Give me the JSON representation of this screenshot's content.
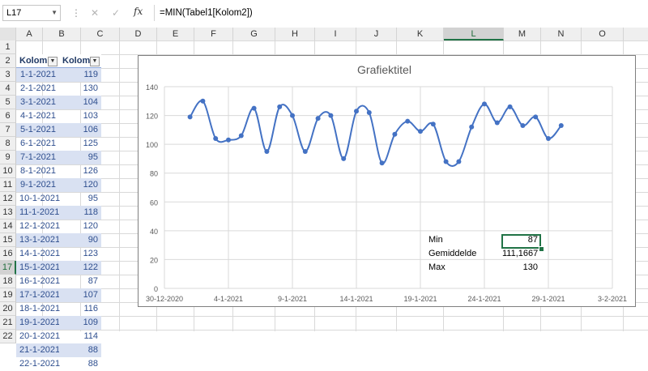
{
  "formula_bar": {
    "name_box": "L17",
    "fx_label": "fx",
    "formula": "=MIN(Tabel1[Kolom2])"
  },
  "columns": [
    "A",
    "B",
    "C",
    "D",
    "E",
    "F",
    "G",
    "H",
    "I",
    "J",
    "K",
    "L",
    "M",
    "N",
    "O"
  ],
  "rows": [
    "1",
    "2",
    "3",
    "4",
    "5",
    "6",
    "7",
    "8",
    "9",
    "10",
    "11",
    "12",
    "13",
    "14",
    "15",
    "16",
    "17",
    "18",
    "19",
    "20",
    "21",
    "22"
  ],
  "selected_column": "L",
  "selected_row": "17",
  "table": {
    "headers": [
      "Kolom1",
      "Kolom2"
    ],
    "dates": [
      "1-1-2021",
      "2-1-2021",
      "3-1-2021",
      "4-1-2021",
      "5-1-2021",
      "6-1-2021",
      "7-1-2021",
      "8-1-2021",
      "9-1-2021",
      "10-1-2021",
      "11-1-2021",
      "12-1-2021",
      "13-1-2021",
      "14-1-2021",
      "15-1-2021",
      "16-1-2021",
      "17-1-2021",
      "18-1-2021",
      "19-1-2021",
      "20-1-2021",
      "21-1-2021",
      "22-1-2021"
    ],
    "values": [
      119,
      130,
      104,
      103,
      106,
      125,
      95,
      126,
      120,
      95,
      118,
      120,
      90,
      123,
      122,
      87,
      107,
      116,
      109,
      114,
      88,
      88
    ]
  },
  "stats": {
    "min_label": "Min",
    "min_value": "87",
    "avg_label": "Gemiddelde",
    "avg_value": "111,1667",
    "max_label": "Max",
    "max_value": "130"
  },
  "chart_data": {
    "type": "line",
    "title": "Grafiektitel",
    "x_tick_labels": [
      "30-12-2020",
      "4-1-2021",
      "9-1-2021",
      "14-1-2021",
      "19-1-2021",
      "24-1-2021",
      "29-1-2021",
      "3-2-2021"
    ],
    "x_start": "2020-12-30",
    "x_end": "2021-02-03",
    "ylim": [
      0,
      140
    ],
    "y_ticks": [
      0,
      20,
      40,
      60,
      80,
      100,
      120,
      140
    ],
    "grid": true,
    "smooth": true,
    "color": "#4472c4",
    "x": [
      "2021-01-01",
      "2021-01-02",
      "2021-01-03",
      "2021-01-04",
      "2021-01-05",
      "2021-01-06",
      "2021-01-07",
      "2021-01-08",
      "2021-01-09",
      "2021-01-10",
      "2021-01-11",
      "2021-01-12",
      "2021-01-13",
      "2021-01-14",
      "2021-01-15",
      "2021-01-16",
      "2021-01-17",
      "2021-01-18",
      "2021-01-19",
      "2021-01-20",
      "2021-01-21",
      "2021-01-22",
      "2021-01-23",
      "2021-01-24",
      "2021-01-25",
      "2021-01-26",
      "2021-01-27",
      "2021-01-28",
      "2021-01-29",
      "2021-01-30"
    ],
    "y": [
      119,
      130,
      104,
      103,
      106,
      125,
      95,
      126,
      120,
      95,
      118,
      120,
      90,
      123,
      122,
      87,
      107,
      116,
      109,
      114,
      88,
      88,
      112,
      128,
      115,
      126,
      113,
      119,
      104,
      113
    ]
  }
}
